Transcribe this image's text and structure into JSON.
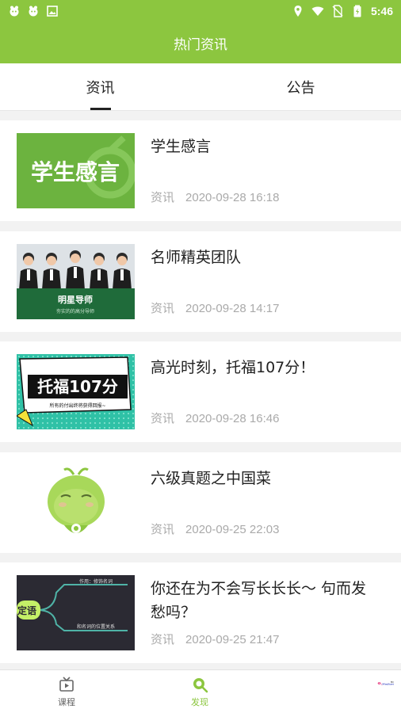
{
  "status_bar": {
    "time": "5:46"
  },
  "app_bar": {
    "title": "热门资讯"
  },
  "tabs": [
    {
      "label": "资讯",
      "active": true
    },
    {
      "label": "公告",
      "active": false
    }
  ],
  "articles": [
    {
      "title": "学生感言",
      "category": "资讯",
      "date": "2020-09-28 16:18",
      "thumb_text": "学生感言"
    },
    {
      "title": "名师精英团队",
      "category": "资讯",
      "date": "2020-09-28 14:17",
      "thumb_text": "明星导师",
      "thumb_subtext": "夯实的的高分导师"
    },
    {
      "title": "高光时刻，托福107分！",
      "category": "资讯",
      "date": "2020-09-28 16:46",
      "thumb_text": "托福107分",
      "thumb_subtext": "所有的付出终将获得回报~"
    },
    {
      "title": "六级真题之中国菜",
      "category": "资讯",
      "date": "2020-09-25 22:03"
    },
    {
      "title": "你还在为不会写长长长～ 句而发愁吗？",
      "category": "资讯",
      "date": "2020-09-25 21:47",
      "thumb_text": "定语",
      "thumb_label1": "作用：修饰名词",
      "thumb_label2": "和名词的位置关系"
    }
  ],
  "bottom_nav": [
    {
      "label": "课程",
      "icon": "play-icon",
      "active": false
    },
    {
      "label": "发现",
      "icon": "search-icon",
      "active": true
    }
  ],
  "watermark": {
    "text": "XYouXi.net",
    "subtext": "X游戏"
  },
  "colors": {
    "primary": "#8cc63f",
    "text": "#222222",
    "meta": "#aaaaaa"
  }
}
